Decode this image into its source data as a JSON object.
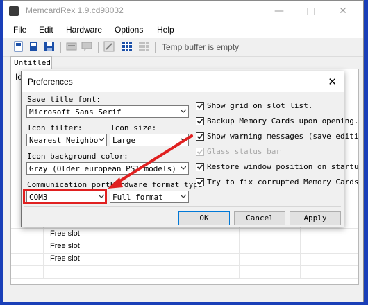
{
  "window": {
    "title": "MemcardRex 1.9.cd98032"
  },
  "menu": [
    "File",
    "Edit",
    "Hardware",
    "Options",
    "Help"
  ],
  "toolbar": {
    "status": "Temp buffer is empty"
  },
  "tab": {
    "label": "Untitled"
  },
  "grid": {
    "col_icon_label": "Ic",
    "free_slots": [
      "Free slot",
      "Free slot",
      "Free slot"
    ]
  },
  "dialog": {
    "title": "Preferences",
    "save_title_font": {
      "label": "Save title font:",
      "value": "Microsoft Sans Serif"
    },
    "icon_filter": {
      "label": "Icon filter:",
      "value": "Nearest Neighbo"
    },
    "icon_size": {
      "label": "Icon size:",
      "value": "Large"
    },
    "icon_bg": {
      "label": "Icon background color:",
      "value": "Gray (Older european PS1 models)"
    },
    "comm_port": {
      "label": "Communication port:",
      "value": "COM3"
    },
    "hw_format": {
      "label": "Hardware format type",
      "value": "Full format"
    },
    "checkboxes": [
      {
        "label": "Show grid on slot list.",
        "checked": true,
        "enabled": true
      },
      {
        "label": "Backup Memory Cards upon opening.",
        "checked": true,
        "enabled": true
      },
      {
        "label": "Show warning messages (save editi",
        "checked": true,
        "enabled": true
      },
      {
        "label": "Glass status bar",
        "checked": true,
        "enabled": false
      },
      {
        "label": "Restore window position on startu",
        "checked": true,
        "enabled": true
      },
      {
        "label": "Try to fix corrupted Memory Cards",
        "checked": true,
        "enabled": true
      }
    ],
    "buttons": {
      "ok": "OK",
      "cancel": "Cancel",
      "apply": "Apply"
    }
  },
  "colors": {
    "desktop": "#1a3fb8",
    "annotation": "#e02020",
    "accent": "#0078d7"
  }
}
